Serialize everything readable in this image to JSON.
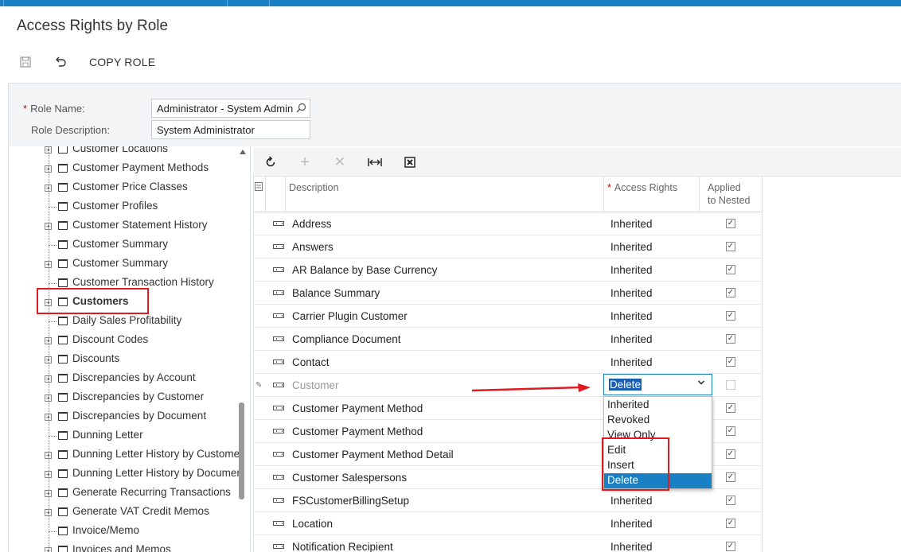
{
  "page": {
    "title": "Access Rights by Role"
  },
  "toolbar": {
    "save_icon": "save-icon",
    "undo_icon": "undo-icon",
    "copy_role_label": "COPY ROLE"
  },
  "form": {
    "role_name_label": "Role Name:",
    "role_name_value": "Administrator - System Admin",
    "role_description_label": "Role Description:",
    "role_description_value": "System Administrator"
  },
  "tree": {
    "items": [
      {
        "label": "Customer Locations",
        "expandable": true
      },
      {
        "label": "Customer Payment Methods",
        "expandable": true
      },
      {
        "label": "Customer Price Classes",
        "expandable": true
      },
      {
        "label": "Customer Profiles",
        "expandable": false
      },
      {
        "label": "Customer Statement History",
        "expandable": true
      },
      {
        "label": "Customer Summary",
        "expandable": false
      },
      {
        "label": "Customer Summary",
        "expandable": true
      },
      {
        "label": "Customer Transaction History",
        "expandable": false
      },
      {
        "label": "Customers",
        "expandable": true,
        "bold": true
      },
      {
        "label": "Daily Sales Profitability",
        "expandable": false
      },
      {
        "label": "Discount Codes",
        "expandable": true
      },
      {
        "label": "Discounts",
        "expandable": true
      },
      {
        "label": "Discrepancies by Account",
        "expandable": true
      },
      {
        "label": "Discrepancies by Customer",
        "expandable": true
      },
      {
        "label": "Discrepancies by Document",
        "expandable": true
      },
      {
        "label": "Dunning Letter",
        "expandable": false
      },
      {
        "label": "Dunning Letter History by Customer",
        "expandable": true
      },
      {
        "label": "Dunning Letter History by Documen",
        "expandable": true
      },
      {
        "label": "Generate Recurring Transactions",
        "expandable": true
      },
      {
        "label": "Generate VAT Credit Memos",
        "expandable": true
      },
      {
        "label": "Invoice/Memo",
        "expandable": false
      },
      {
        "label": "Invoices and Memos",
        "expandable": true
      }
    ]
  },
  "grid_toolbar": {
    "refresh_icon": "refresh-icon",
    "add_icon": "add-icon",
    "delete_icon": "delete-icon",
    "fit_icon": "fit-columns-icon",
    "excel_icon": "excel-export-icon"
  },
  "grid": {
    "columns": {
      "description": "Description",
      "access_rights": "Access Rights",
      "applied_line1": "Applied",
      "applied_line2": "to Nested"
    },
    "rows": [
      {
        "description": "Address",
        "access": "Inherited",
        "applied": true
      },
      {
        "description": "Answers",
        "access": "Inherited",
        "applied": true
      },
      {
        "description": "AR Balance by Base Currency",
        "access": "Inherited",
        "applied": true
      },
      {
        "description": "Balance Summary",
        "access": "Inherited",
        "applied": true
      },
      {
        "description": "Carrier Plugin Customer",
        "access": "Inherited",
        "applied": true
      },
      {
        "description": "Compliance Document",
        "access": "Inherited",
        "applied": true
      },
      {
        "description": "Contact",
        "access": "Inherited",
        "applied": true
      },
      {
        "description": "Customer",
        "access": "Delete",
        "applied": false,
        "editing": true
      },
      {
        "description": "Customer Payment Method",
        "access": "",
        "applied": true
      },
      {
        "description": "Customer Payment Method",
        "access": "",
        "applied": true
      },
      {
        "description": "Customer Payment Method Detail",
        "access": "",
        "applied": true
      },
      {
        "description": "Customer Salespersons",
        "access": "",
        "applied": true
      },
      {
        "description": "FSCustomerBillingSetup",
        "access": "Inherited",
        "applied": true
      },
      {
        "description": "Location",
        "access": "Inherited",
        "applied": true
      },
      {
        "description": "Notification Recipient",
        "access": "Inherited",
        "applied": true
      }
    ]
  },
  "dropdown": {
    "selected": "Delete",
    "options": [
      "Inherited",
      "Revoked",
      "View Only",
      "Edit",
      "Insert",
      "Delete"
    ]
  }
}
